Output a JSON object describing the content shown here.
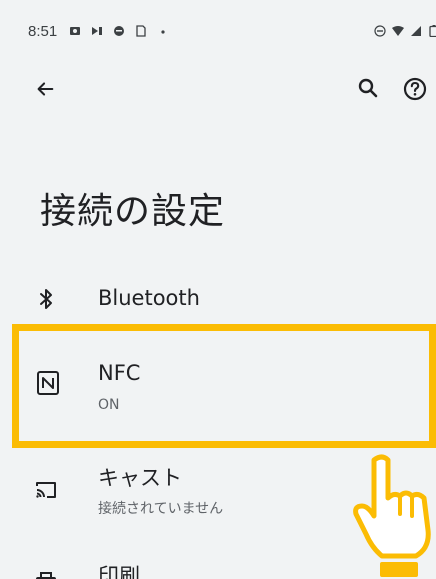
{
  "status_bar": {
    "time": "8:51"
  },
  "title": "接続の設定",
  "items": [
    {
      "title": "Bluetooth",
      "subtitle": ""
    },
    {
      "title": "NFC",
      "subtitle": "ON"
    },
    {
      "title": "キャスト",
      "subtitle": "接続されていません"
    },
    {
      "title": "印刷",
      "subtitle": ""
    }
  ],
  "colors": {
    "highlight": "#fbbc04",
    "background": "#f1f3f4",
    "text": "#202124",
    "subtext": "#5f6368"
  },
  "icons": [
    "back-arrow-icon",
    "search-icon",
    "help-icon",
    "bluetooth-icon",
    "nfc-icon",
    "cast-icon",
    "print-icon",
    "pointing-hand-icon"
  ]
}
